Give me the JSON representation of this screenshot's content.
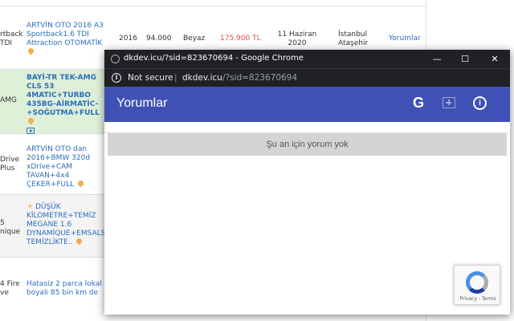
{
  "background": {
    "rows": [
      {
        "left_text": "rtback\nTDI",
        "title": "ARTVİN OTO 2016 A3 Sportback1.6 TDI Attraction OTOMATİK",
        "year": "2016",
        "km": "94.000",
        "color": "Beyaz",
        "price": "175.900 TL",
        "date": "11 Haziran 2020",
        "location": "İstanbul Ataşehir",
        "link": "Yorumlar"
      },
      {
        "left_text": "AMG",
        "title": "BAYİ-TR TEK-AMG CLS 53 4MATIC+TURBO 435BG-AİRMATİC-+SOĞUTMA+FULL"
      },
      {
        "left_text": "Drive\nPlus",
        "title": "ARTVİN OTO dan 2016+BMW 320d xDrive+CAM TAVAN+4x4 ÇEKER+FULL"
      },
      {
        "left_text": "5\nnique",
        "title": "DÜŞÜK KİLOMETRE+TEMİZ MEGANE 1.6 DYNAMİQUE+EMSALSİZ TEMİZLİKTE.."
      },
      {
        "left_text": "4 Fire\nve",
        "title": "Hatasiz 2 parca lokal boyali 85 bin km de"
      }
    ]
  },
  "window": {
    "title": "dkdev.icu/?sid=823670694 - Google Chrome",
    "controls": {
      "minimize": "—",
      "maximize": "☐",
      "close": "✕"
    },
    "address": {
      "security": "Not secure",
      "separator": "|",
      "host": "dkdev.icu",
      "path": "/?sid=823670694"
    }
  },
  "app": {
    "title": "Yorumlar",
    "g_label": "G",
    "about_label": "i",
    "empty_message": "Şu an için yorum yok"
  },
  "recaptcha": {
    "links": "Privacy - Terms"
  }
}
